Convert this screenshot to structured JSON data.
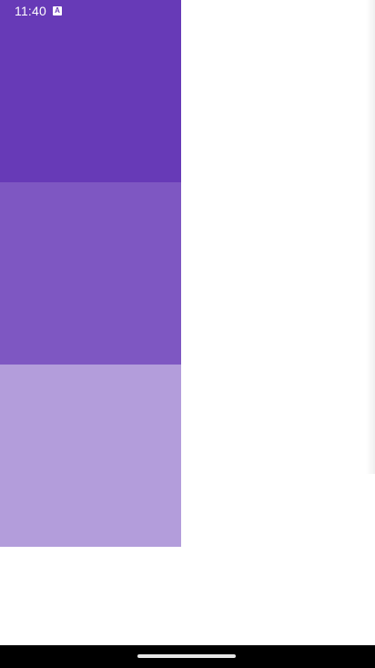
{
  "status_bar": {
    "time": "11:40",
    "icon": "text-a-icon",
    "icon_glyph": "A"
  },
  "blocks": [
    {
      "name": "color-block-1",
      "color": "#673ab7"
    },
    {
      "name": "color-block-2",
      "color": "#7e57c2"
    },
    {
      "name": "color-block-3",
      "color": "#b39ddb"
    }
  ],
  "nav_bar": {
    "handle": "home-gesture-handle"
  }
}
